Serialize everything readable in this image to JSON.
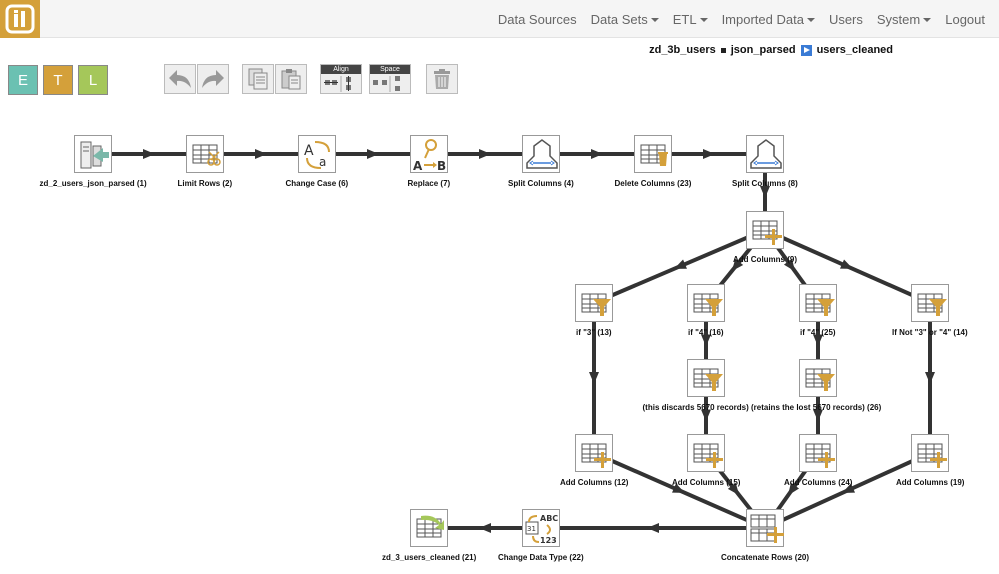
{
  "nav": {
    "items": [
      "Data Sources",
      "Data Sets",
      "ETL",
      "Imported Data",
      "Users",
      "System",
      "Logout"
    ]
  },
  "breadcrumb": {
    "parts": [
      "zd_3b_users",
      "json_parsed",
      "users_cleaned"
    ]
  },
  "etl_buttons": [
    "E",
    "T",
    "L"
  ],
  "toolbar": {
    "align_label": "Align",
    "space_label": "Space"
  },
  "colors": {
    "accent": "#d4a03a",
    "e_button": "#6bc1b2",
    "t_button": "#d4a03a",
    "l_button": "#a5c75a"
  },
  "nodes": [
    {
      "label": "zd_2_users_json_parsed (1)",
      "icon": "source"
    },
    {
      "label": "Limit Rows (2)",
      "icon": "limit-rows"
    },
    {
      "label": "Change Case (6)",
      "icon": "change-case"
    },
    {
      "label": "Replace (7)",
      "icon": "replace"
    },
    {
      "label": "Split Columns (4)",
      "icon": "split"
    },
    {
      "label": "Delete Columns (23)",
      "icon": "delete-columns"
    },
    {
      "label": "Split Columns (8)",
      "icon": "split"
    },
    {
      "label": "Add Columns (9)",
      "icon": "add-columns"
    },
    {
      "label": "if \"3\" (13)",
      "icon": "filter"
    },
    {
      "label": "if \"4\" (16)",
      "icon": "filter"
    },
    {
      "label": "if \"4\" (25)",
      "icon": "filter"
    },
    {
      "label": "If Not \"3\" or \"4\" (14)",
      "icon": "filter"
    },
    {
      "label": "(this discards 5670 records) (retains the lost 5670 records) (26)",
      "icon": "filter"
    },
    {
      "label": "",
      "icon": "filter"
    },
    {
      "label": "Add Columns (12)",
      "icon": "add-columns"
    },
    {
      "label": "Add Columns (15)",
      "icon": "add-columns"
    },
    {
      "label": "Add Columns (24)",
      "icon": "add-columns"
    },
    {
      "label": "Add Columns (19)",
      "icon": "add-columns"
    },
    {
      "label": "Concatenate Rows (20)",
      "icon": "concat"
    },
    {
      "label": "Change Data Type (22)",
      "icon": "change-type"
    },
    {
      "label": "zd_3_users_cleaned (21)",
      "icon": "destination"
    }
  ]
}
